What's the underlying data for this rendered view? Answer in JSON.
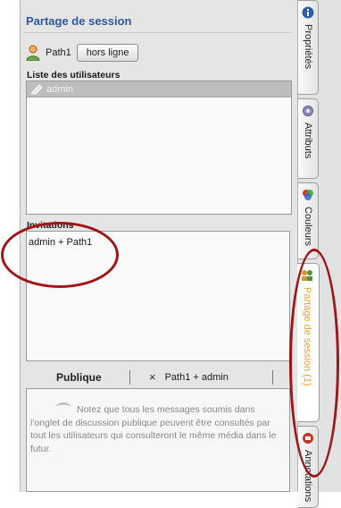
{
  "panel": {
    "title": "Partage de session",
    "user_name": "Path1",
    "status_button": "hors ligne",
    "users_label": "Liste des utilisateurs",
    "users": [
      "admin"
    ],
    "invitations_label": "Invitations",
    "invitations": [
      "admin + Path1"
    ]
  },
  "chat": {
    "tabs": [
      {
        "label": "Publique",
        "active": true
      },
      {
        "label": "Path1 + admin",
        "close": "×"
      }
    ],
    "notice": "Notez que tous les messages soumis dans l'onglet de discussion publique peuvent être consultés par tout les utilisateurs qui consulteront le même média dans le futur."
  },
  "side_tabs": [
    {
      "label": "Propriétés",
      "icon": "info-icon",
      "active": false
    },
    {
      "label": "Attributs",
      "icon": "gear-icon",
      "active": false
    },
    {
      "label": "Couleurs",
      "icon": "palette-icon",
      "active": false
    },
    {
      "label": "Partage de session (1)",
      "icon": "users-icon",
      "active": true
    },
    {
      "label": "Annotations",
      "icon": "annotation-icon",
      "active": false
    }
  ],
  "colors": {
    "title": "#2c5a9c",
    "active_tab_text": "#e7a33a",
    "highlight_ring": "#a01517"
  }
}
